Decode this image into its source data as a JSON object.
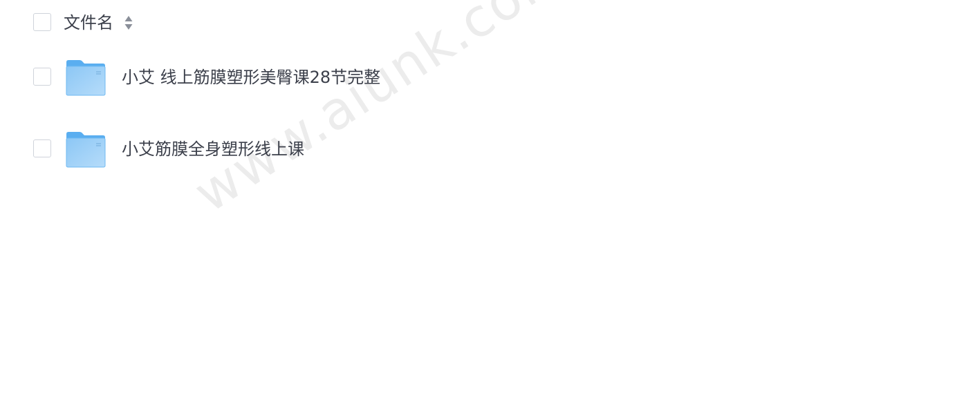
{
  "header": {
    "column_label": "文件名",
    "sort_icon": "sort-icon"
  },
  "files": [
    {
      "name": "小艾 线上筋膜塑形美臀课28节完整",
      "icon": "folder-icon"
    },
    {
      "name": "小艾筋膜全身塑形线上课",
      "icon": "folder-icon"
    }
  ],
  "watermark": "www.aiunk.com",
  "colors": {
    "text": "#3b3f4a",
    "checkbox_border": "#cfd3da",
    "folder_light": "#9ed0f7",
    "folder_dark": "#5aaef0",
    "watermark": "#ececec"
  }
}
